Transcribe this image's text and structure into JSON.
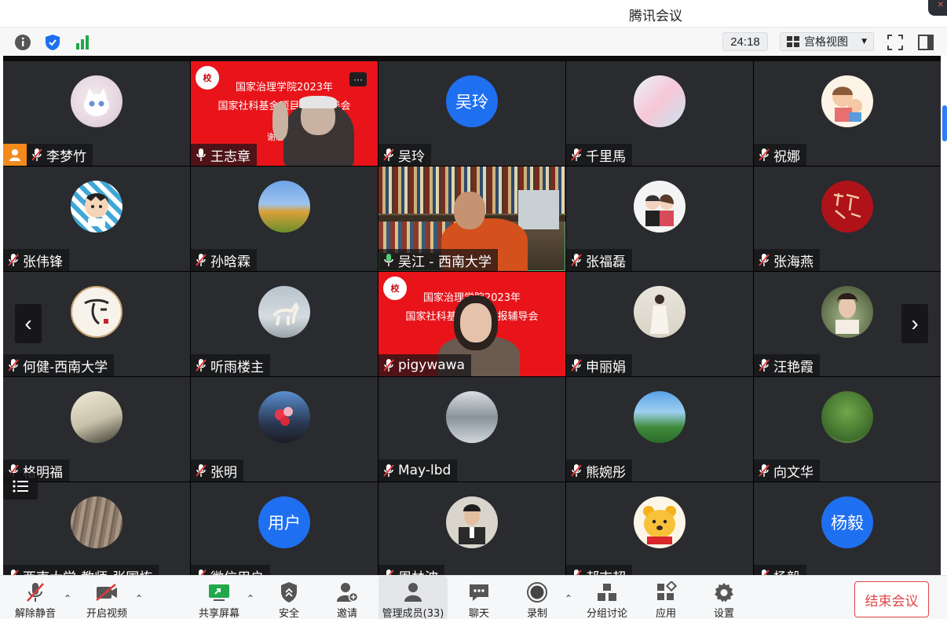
{
  "window": {
    "title": "腾讯会议"
  },
  "toolbar_top": {
    "timer": "24:18",
    "view_mode": "宫格视图"
  },
  "participants": [
    {
      "name": "李梦竹",
      "type": "avatar",
      "host": true
    },
    {
      "name": "王志章",
      "type": "slide",
      "mic": "on",
      "slide_lines": [
        "国家治理学院2023年",
        "国家社科基金项目申报辅导会",
        "谢您参与"
      ]
    },
    {
      "name": "吴玲",
      "type": "initials",
      "initials": "吴玲"
    },
    {
      "name": "千里馬",
      "type": "avatar"
    },
    {
      "name": "祝娜",
      "type": "avatar"
    },
    {
      "name": "张伟锋",
      "type": "avatar"
    },
    {
      "name": "孙晗霖",
      "type": "avatar"
    },
    {
      "name": "吴江 - 西南大学",
      "type": "video",
      "mic": "on",
      "active": true
    },
    {
      "name": "张福磊",
      "type": "avatar"
    },
    {
      "name": "张海燕",
      "type": "avatar"
    },
    {
      "name": "何健-西南大学",
      "type": "avatar"
    },
    {
      "name": "听雨楼主",
      "type": "avatar"
    },
    {
      "name": "pigywawa",
      "type": "slide",
      "slide_lines": [
        "国家治理学院2023年",
        "国家社科基金项目申报辅导会"
      ]
    },
    {
      "name": "申丽娟",
      "type": "avatar"
    },
    {
      "name": "汪艳霞",
      "type": "avatar"
    },
    {
      "name": "格明福",
      "type": "avatar"
    },
    {
      "name": "张明",
      "type": "avatar"
    },
    {
      "name": "May-lbd",
      "type": "avatar"
    },
    {
      "name": "熊婉彤",
      "type": "avatar"
    },
    {
      "name": "向文华",
      "type": "avatar"
    },
    {
      "name": "西南大学-教师-张国栋",
      "type": "avatar"
    },
    {
      "name": "微信用户",
      "type": "initials",
      "initials": "用户"
    },
    {
      "name": "周林波",
      "type": "avatar"
    },
    {
      "name": "郝吉超",
      "type": "avatar"
    },
    {
      "name": "杨毅",
      "type": "initials",
      "initials": "杨毅"
    }
  ],
  "bottom_toolbar": {
    "mute": "解除静音",
    "video": "开启视频",
    "share": "共享屏幕",
    "security": "安全",
    "invite": "邀请",
    "members": "管理成员(33)",
    "chat": "聊天",
    "record": "录制",
    "breakout": "分组讨论",
    "apps": "应用",
    "settings": "设置",
    "end": "结束会议"
  },
  "colors": {
    "accent": "#1f6ff1",
    "end": "#e04646",
    "host_badge": "#f28a1d",
    "slide_red": "#e8141a"
  }
}
